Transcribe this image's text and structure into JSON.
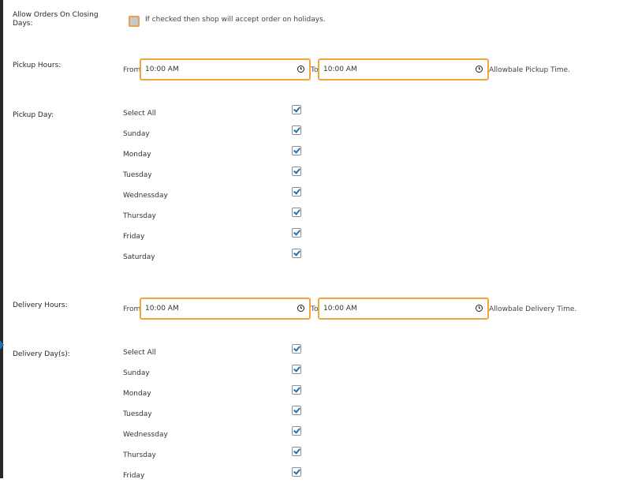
{
  "closing_days": {
    "label": "Allow Orders On Closing Days:",
    "help": "If checked then shop will accept order on holidays.",
    "checked": false
  },
  "pickup_hours": {
    "label": "Pickup Hours:",
    "from_label": "From",
    "from_value": "10:00 AM",
    "to_label": "To",
    "to_value": "10:00 AM",
    "help": "Allowbale Pickup Time."
  },
  "pickup_day": {
    "label": "Pickup Day:",
    "options": [
      {
        "name": "Select All",
        "checked": true
      },
      {
        "name": "Sunday",
        "checked": true
      },
      {
        "name": "Monday",
        "checked": true
      },
      {
        "name": "Tuesday",
        "checked": true
      },
      {
        "name": "Wednessday",
        "checked": true
      },
      {
        "name": "Thursday",
        "checked": true
      },
      {
        "name": "Friday",
        "checked": true
      },
      {
        "name": "Saturday",
        "checked": true
      }
    ]
  },
  "delivery_hours": {
    "label": "Delivery Hours:",
    "from_label": "From",
    "from_value": "10:00 AM",
    "to_label": "To",
    "to_value": "10:00 AM",
    "help": "Allowbale Delivery Time."
  },
  "delivery_day": {
    "label": "Delivery Day(s):",
    "options": [
      {
        "name": "Select All",
        "checked": true
      },
      {
        "name": "Sunday",
        "checked": true
      },
      {
        "name": "Monday",
        "checked": true
      },
      {
        "name": "Tuesday",
        "checked": true
      },
      {
        "name": "Wednessday",
        "checked": true
      },
      {
        "name": "Thursday",
        "checked": true
      },
      {
        "name": "Friday",
        "checked": true
      }
    ]
  }
}
